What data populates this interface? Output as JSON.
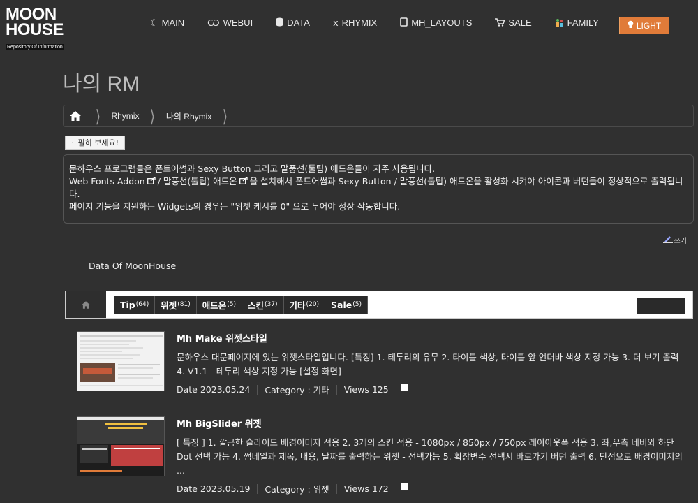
{
  "logo": {
    "line1": "MOON",
    "line2": "HOUSE",
    "tagline": "Repository Of Information"
  },
  "nav": [
    {
      "label": "MAIN",
      "icon": "moon-icon"
    },
    {
      "label": "WEBUI",
      "icon": "webui-icon"
    },
    {
      "label": "DATA",
      "icon": "database-icon"
    },
    {
      "label": "RHYMIX",
      "icon": "rhymix-icon"
    },
    {
      "label": "MH_LAYOUTS",
      "icon": "tablet-icon"
    },
    {
      "label": "SALE",
      "icon": "cart-icon"
    },
    {
      "label": "FAMILY",
      "icon": "family-icon"
    }
  ],
  "light_button": "LIGHT",
  "page_title": "나의 RM",
  "breadcrumb": [
    "Rhymix",
    "나의 Rhymix"
  ],
  "must_read": "필히 보세요!",
  "notice": {
    "line1": "문하우스 프로그램들은 폰트어썸과 Sexy Button 그리고 말풍선(툴팁) 애드온들이 자주 사용됩니다.",
    "line2_a": "Web Fonts Addon",
    "line2_b": "/ 말풍선(툴팁) 애드온",
    "line2_c": "을 설치해서 폰트어썸과 Sexy Button / 말풍선(툴팁) 애드온을 활성화 시켜야 아이콘과 버턴들이 정상적으로 출력됩니다.",
    "line3": "페이지 기능을 지원하는 Widgets의 경우는 \"위젯 케시를 0\" 으로 두어야 정상 작동합니다."
  },
  "write_label": "쓰기",
  "board_title": "Data Of MoonHouse",
  "categories": [
    {
      "label": "Tip",
      "count": "(64)"
    },
    {
      "label": "위젯",
      "count": "(81)"
    },
    {
      "label": "애드온",
      "count": "(5)"
    },
    {
      "label": "스킨",
      "count": "(37)"
    },
    {
      "label": "기타",
      "count": "(20)"
    },
    {
      "label": "Sale",
      "count": "(5)"
    }
  ],
  "posts": [
    {
      "title": "Mh Make 위젯스타일",
      "desc": "문하우스 대문페이지에 있는 위젯스타일입니다. [특징] 1. 테두리의 유무 2. 타이틀 색상, 타이틀 앞 언더바 색상 지정 가능 3. 더 보기 출력 4. V1.1 - 테두리 색상 지정 가능 [설정 화면]",
      "date": "Date 2023.05.24",
      "category": "Category : 기타",
      "views": "Views 125"
    },
    {
      "title": "Mh BigSlider 위젯",
      "desc": "[ 특징 ] 1. 깔금한 슬라이드 배경이미지 적용 2. 3개의 스킨 적용 - 1080px / 850px / 750px 레이아웃폭 적용 3. 좌,우측 네비와 하단 Dot 선택 가능 4. 썸네일과 제목, 내용, 날짜를 출력하는 위젯 - 선택가능 5. 확장변수 선택시 바로가기 버턴 출력 6. 단점으로 배경이미지의 ...",
      "date": "Date 2023.05.19",
      "category": "Category : 위젯",
      "views": "Views 172"
    }
  ],
  "colors": {
    "background": "#303030",
    "accent": "#e07b39"
  }
}
